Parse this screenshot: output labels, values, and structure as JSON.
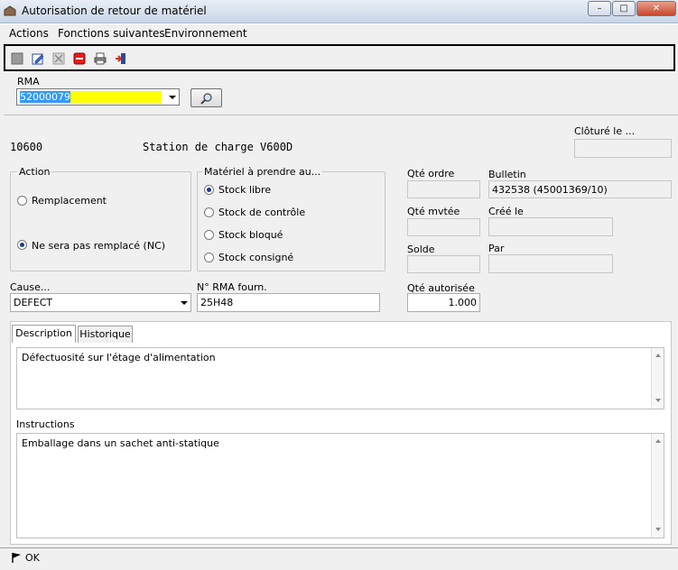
{
  "window": {
    "title": "Autorisation de retour de matériel",
    "minimize": "–",
    "maximize": "□",
    "close": "✕"
  },
  "menu": {
    "items": [
      "Actions",
      "Fonctions suivantes",
      "Environnement"
    ]
  },
  "toolbar": {
    "icons": [
      "new-doc-icon",
      "edit-icon",
      "cancel-icon",
      "delete-icon",
      "print-icon",
      "exit-icon"
    ]
  },
  "rma": {
    "label": "RMA",
    "value": "52000079"
  },
  "main": {
    "item_code": "10600",
    "item_description": "Station de charge V600D",
    "cloture_label": "Clôturé le ...",
    "action": {
      "label": "Action",
      "options": [
        "Remplacement",
        "Ne sera pas remplacé (NC)"
      ],
      "selected": 1
    },
    "materiel": {
      "label": "Matériel à prendre au...",
      "options": [
        "Stock libre",
        "Stock de contrôle",
        "Stock bloqué",
        "Stock consigné"
      ],
      "selected": 0
    },
    "qte_ordre_label": "Qté ordre",
    "qte_mvtee_label": "Qté mvtée",
    "solde_label": "Solde",
    "bulletin_label": "Bulletin",
    "bulletin_value": "432538 (45001369/10)",
    "cree_le_label": "Créé le",
    "par_label": "Par",
    "cause_label": "Cause...",
    "cause_value": "DEFECT",
    "rma_fourn_label": "N° RMA fourn.",
    "rma_fourn_value": "25H48",
    "qte_autorisee_label": "Qté autorisée",
    "qte_autorisee_value": "1.000",
    "tabs": [
      "Description",
      "Historique"
    ],
    "description_text": "Défectuosité sur l'étage d'alimentation",
    "instructions_label": "Instructions",
    "instructions_text": "Emballage dans un sachet anti-statique"
  },
  "status": {
    "text": "OK"
  },
  "colors": {
    "highlight": "#ffff00",
    "selection": "#3399ff"
  }
}
